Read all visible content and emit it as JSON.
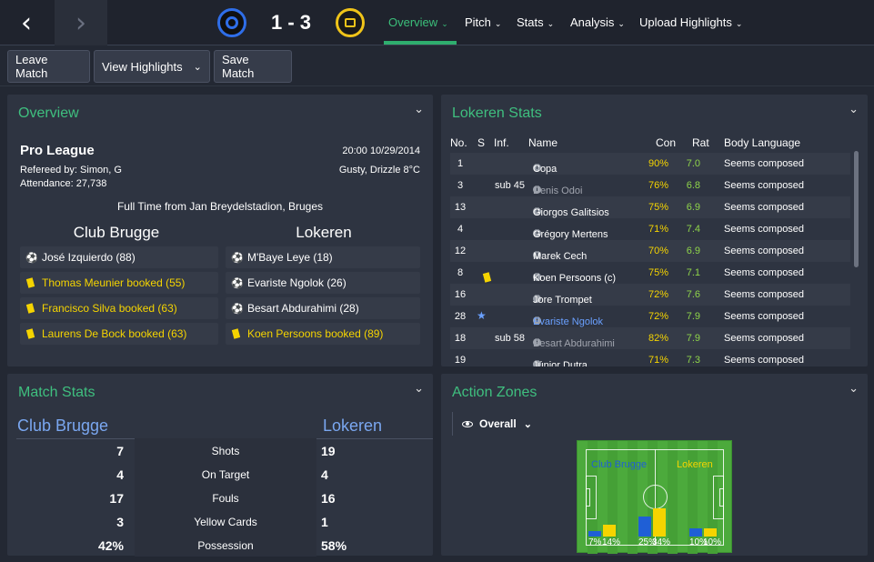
{
  "header": {
    "back_icon": "‹",
    "forward_icon": "›",
    "score": "1 - 3",
    "tabs": [
      {
        "label": "Overview",
        "chevron": "⌄"
      },
      {
        "label": "Pitch",
        "chevron": "⌄"
      },
      {
        "label": "Stats",
        "chevron": "⌄"
      },
      {
        "label": "Analysis",
        "chevron": "⌄"
      },
      {
        "label": "Upload Highlights",
        "chevron": "⌄"
      }
    ],
    "active_tab_color": "#3bbf7a",
    "home_crest_color": "#2f6ee8",
    "away_crest_color": "#f0c419"
  },
  "toolbar": {
    "leave_label": "Leave Match",
    "highlights_label": "View Highlights",
    "highlights_chevron": "⌄",
    "save_label": "Save Match"
  },
  "overview": {
    "title": "Overview",
    "collapse_icon": "⌄",
    "league": "Pro League",
    "datetime": "20:00 10/29/2014",
    "referee": "Refereed by: Simon, G",
    "weather": "Gusty, Drizzle 8°C",
    "attendance": "Attendance: 27,738",
    "fulltime": "Full Time from Jan Breydelstadion, Bruges",
    "home_team": "Club Brugge",
    "away_team": "Lokeren",
    "home_events": [
      {
        "text": "José Izquierdo (88)",
        "type": "goal"
      },
      {
        "text": "Thomas Meunier booked (55)",
        "type": "booking"
      },
      {
        "text": "Francisco Silva booked (63)",
        "type": "booking"
      },
      {
        "text": "Laurens De Bock booked (63)",
        "type": "booking"
      }
    ],
    "away_events": [
      {
        "text": "M'Baye Leye (18)",
        "type": "goal"
      },
      {
        "text": "Evariste Ngolok (26)",
        "type": "goal"
      },
      {
        "text": "Besart Abdurahimi (28)",
        "type": "goal"
      },
      {
        "text": "Koen Persoons booked (89)",
        "type": "booking"
      }
    ]
  },
  "lokeren_stats": {
    "title": "Lokeren Stats",
    "collapse_icon": "⌄",
    "columns": [
      "No.",
      "S",
      "Inf.",
      "Name",
      "Con",
      "Rat",
      "Body Language"
    ],
    "rows": [
      {
        "no": "1",
        "s": "",
        "inf": "",
        "name": "Copa",
        "con": "90%",
        "rat": "7.0",
        "body": "Seems composed",
        "style": "normal"
      },
      {
        "no": "3",
        "s": "",
        "inf": "sub 45",
        "name": "Denis Odoi",
        "con": "76%",
        "rat": "6.8",
        "body": "Seems composed",
        "style": "dim"
      },
      {
        "no": "13",
        "s": "",
        "inf": "",
        "name": "Giorgos Galitsios",
        "con": "75%",
        "rat": "6.9",
        "body": "Seems composed",
        "style": "normal"
      },
      {
        "no": "4",
        "s": "",
        "inf": "",
        "name": "Grégory Mertens",
        "con": "71%",
        "rat": "7.4",
        "body": "Seems composed",
        "style": "normal"
      },
      {
        "no": "12",
        "s": "",
        "inf": "",
        "name": "Marek Cech",
        "con": "70%",
        "rat": "6.9",
        "body": "Seems composed",
        "style": "normal"
      },
      {
        "no": "8",
        "s": "card",
        "inf": "",
        "name": "Koen Persoons (c)",
        "con": "75%",
        "rat": "7.1",
        "body": "Seems composed",
        "style": "normal"
      },
      {
        "no": "16",
        "s": "",
        "inf": "",
        "name": "Jore Trompet",
        "con": "72%",
        "rat": "7.6",
        "body": "Seems composed",
        "style": "normal"
      },
      {
        "no": "28",
        "s": "star",
        "inf": "",
        "name": "Evariste Ngolok",
        "con": "72%",
        "rat": "7.9",
        "body": "Seems composed",
        "style": "blue"
      },
      {
        "no": "18",
        "s": "",
        "inf": "sub 58",
        "name": "Besart Abdurahimi",
        "con": "82%",
        "rat": "7.9",
        "body": "Seems composed",
        "style": "dim"
      },
      {
        "no": "19",
        "s": "",
        "inf": "",
        "name": "Júnior Dutra",
        "con": "71%",
        "rat": "7.3",
        "body": "Seems composed",
        "style": "normal"
      }
    ]
  },
  "match_stats": {
    "title": "Match Stats",
    "collapse_icon": "⌄",
    "home_team": "Club Brugge",
    "away_team": "Lokeren",
    "rows": [
      {
        "home": "7",
        "label": "Shots",
        "away": "19"
      },
      {
        "home": "4",
        "label": "On Target",
        "away": "4"
      },
      {
        "home": "17",
        "label": "Fouls",
        "away": "16"
      },
      {
        "home": "3",
        "label": "Yellow Cards",
        "away": "1"
      },
      {
        "home": "42%",
        "label": "Possession",
        "away": "58%"
      }
    ]
  },
  "action_zones": {
    "title": "Action Zones",
    "collapse_icon": "⌄",
    "filter_label": "Overall",
    "filter_chevron": "⌄",
    "home_label": "Club Brugge",
    "away_label": "Lokeren",
    "home_color": "#1f5fd6",
    "away_color": "#f5d400",
    "zones": [
      {
        "home_pct": 7,
        "away_pct": 14,
        "home_label": "7%",
        "away_label": "14%"
      },
      {
        "home_pct": 25,
        "away_pct": 34,
        "home_label": "25%",
        "away_label": "34%"
      },
      {
        "home_pct": 10,
        "away_pct": 10,
        "home_label": "10%",
        "away_label": "10%"
      }
    ]
  }
}
